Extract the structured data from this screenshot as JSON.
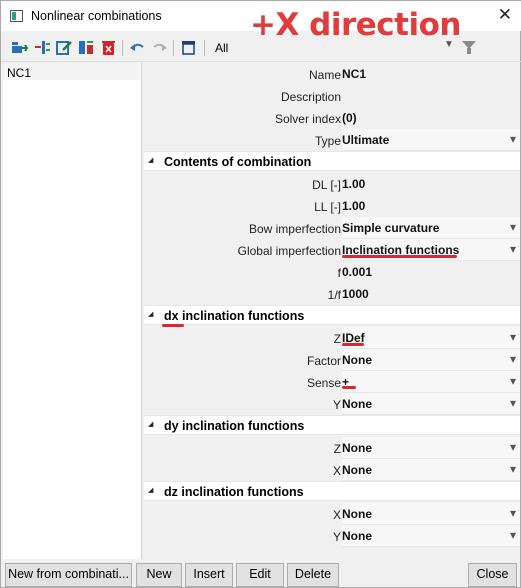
{
  "window": {
    "title": "Nonlinear combinations",
    "close_glyph": "✕",
    "overlay_caption": "+X direction"
  },
  "toolbar": {
    "filter_value": "All"
  },
  "list": {
    "items": [
      "NC1"
    ]
  },
  "props": {
    "name": {
      "label": "Name",
      "value": "NC1"
    },
    "description": {
      "label": "Description",
      "value": ""
    },
    "solver_index": {
      "label": "Solver index",
      "value": "(0)"
    },
    "type": {
      "label": "Type",
      "value": "Ultimate"
    }
  },
  "sections": {
    "contents": "Contents of combination",
    "dx": "dx inclination functions",
    "dy": "dy inclination functions",
    "dz": "dz inclination functions"
  },
  "contents": {
    "dl": {
      "label": "DL [-]",
      "value": "1.00"
    },
    "ll": {
      "label": "LL [-]",
      "value": "1.00"
    },
    "bow": {
      "label": "Bow imperfection",
      "value": "Simple curvature"
    },
    "global": {
      "label": "Global imperfection",
      "value": "Inclination functions"
    },
    "f": {
      "label": "f",
      "value": "0.001"
    },
    "inv_f": {
      "label": "1/f",
      "value": "1000"
    }
  },
  "dx": {
    "z": {
      "label": "Z",
      "value": "IDef"
    },
    "factor": {
      "label": "Factor",
      "value": "None"
    },
    "sense": {
      "label": "Sense",
      "value": "+"
    },
    "y": {
      "label": "Y",
      "value": "None"
    }
  },
  "dy": {
    "z": {
      "label": "Z",
      "value": "None"
    },
    "x": {
      "label": "X",
      "value": "None"
    }
  },
  "dz": {
    "x": {
      "label": "X",
      "value": "None"
    },
    "y": {
      "label": "Y",
      "value": "None"
    }
  },
  "buttons": {
    "new_from": "New from combinati...",
    "new": "New",
    "insert": "Insert",
    "edit": "Edit",
    "delete": "Delete",
    "close": "Close"
  },
  "colors": {
    "highlight": "#d9292e",
    "overlay": "#e23b3b"
  }
}
